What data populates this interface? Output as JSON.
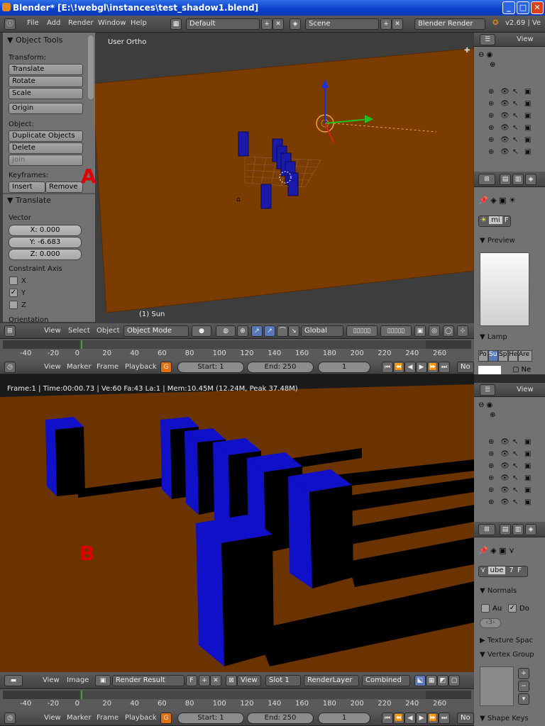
{
  "window": {
    "title": "Blender* [E:\\!webgl\\instances\\test_shadow1.blend]",
    "min": "_",
    "max": "□",
    "close": "✕"
  },
  "topbar": {
    "menus": [
      "File",
      "Add",
      "Render",
      "Window",
      "Help"
    ],
    "layout": "Default",
    "scene": "Scene",
    "engine": "Blender Render",
    "version": "v2.69 | Ve"
  },
  "toolshelf": {
    "title": "Object Tools",
    "transform_label": "Transform:",
    "translate": "Translate",
    "rotate": "Rotate",
    "scale": "Scale",
    "origin": "Origin",
    "object_label": "Object:",
    "duplicate": "Duplicate Objects",
    "delete": "Delete",
    "join": "Join",
    "keyframes_label": "Keyframes:",
    "insert": "Insert",
    "remove": "Remove",
    "op_title": "Translate",
    "vector_label": "Vector",
    "x": "X: 0.000",
    "y": "Y: -6.683",
    "z": "Z: 0.000",
    "constraint_label": "Constraint Axis",
    "cx": "X",
    "cy": "Y",
    "cz": "Z",
    "orientation_label": "Orientation"
  },
  "viewport": {
    "view_label": "User Ortho",
    "object_label": "(1) Sun",
    "menus": [
      "View",
      "Select",
      "Object"
    ],
    "mode": "Object Mode",
    "orientation": "Global"
  },
  "timeline": {
    "ticks": [
      "-40",
      "-20",
      "0",
      "20",
      "40",
      "60",
      "80",
      "100",
      "120",
      "140",
      "160",
      "180",
      "200",
      "220",
      "240",
      "260"
    ],
    "menus": [
      "View",
      "Marker",
      "Frame",
      "Playback"
    ],
    "start": "Start: 1",
    "end": "End: 250",
    "current": "1",
    "no": "No"
  },
  "outliner": {
    "view": "View"
  },
  "properties_top": {
    "material_short": "mi",
    "material_f": "F",
    "preview_label": "Preview",
    "lamp_label": "Lamp",
    "lamp_tabs": [
      "Po",
      "Su",
      "Sp",
      "He",
      "Are"
    ],
    "ne": "Ne"
  },
  "render": {
    "info": "Frame:1 | Time:00:00.73 | Ve:60 Fa:43 La:1 | Mem:10.45M (12.24M, Peak 37.48M)",
    "menus": [
      "View",
      "Image"
    ],
    "image_name": "Render Result",
    "f": "F",
    "view_btn": "View",
    "slot": "Slot 1",
    "layer": "RenderLayer",
    "pass": "Combined"
  },
  "properties_bottom": {
    "mesh_short": "ube",
    "users": "7",
    "f": "F",
    "normals_label": "Normals",
    "au": "Au",
    "do": "Do",
    "angle": "3",
    "texture_space": "Texture Spac",
    "vertex_groups": "Vertex Group",
    "shape_keys": "Shape Keys"
  },
  "annotations": {
    "a": "A",
    "b": "B"
  }
}
